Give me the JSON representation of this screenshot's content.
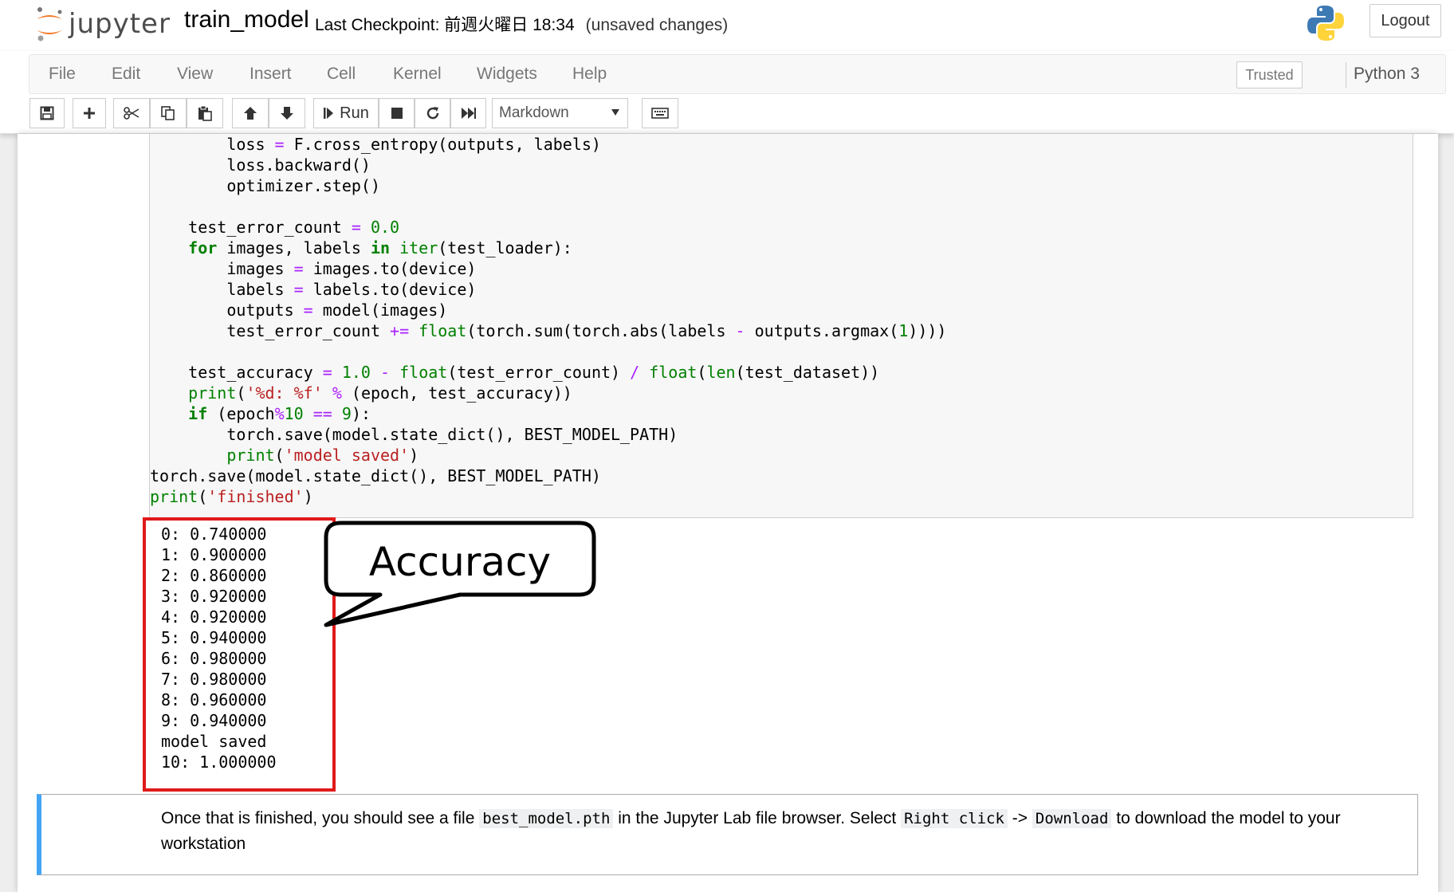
{
  "header": {
    "logo_text": "jupyter",
    "notebook_name": "train_model",
    "checkpoint_text": "Last Checkpoint: 前週火曜日 18:34",
    "unsaved_text": "(unsaved changes)",
    "logout_label": "Logout"
  },
  "menubar": {
    "items": [
      "File",
      "Edit",
      "View",
      "Insert",
      "Cell",
      "Kernel",
      "Widgets",
      "Help"
    ],
    "trusted_label": "Trusted",
    "kernel_name": "Python 3"
  },
  "toolbar": {
    "run_label": "Run",
    "cell_type": "Markdown"
  },
  "code_lines": [
    "        loss = F.cross_entropy(outputs, labels)",
    "        loss.backward()",
    "        optimizer.step()",
    "",
    "    test_error_count = 0.0",
    "    for images, labels in iter(test_loader):",
    "        images = images.to(device)",
    "        labels = labels.to(device)",
    "        outputs = model(images)",
    "        test_error_count += float(torch.sum(torch.abs(labels - outputs.argmax(1))))",
    "",
    "    test_accuracy = 1.0 - float(test_error_count) / float(len(test_dataset))",
    "    print('%d: %f' % (epoch, test_accuracy))",
    "    if (epoch%10 == 9):",
    "        torch.save(model.state_dict(), BEST_MODEL_PATH)",
    "        print('model saved')",
    "torch.save(model.state_dict(), BEST_MODEL_PATH)",
    "print('finished')"
  ],
  "output_lines": [
    "0: 0.740000",
    "1: 0.900000",
    "2: 0.860000",
    "3: 0.920000",
    "4: 0.920000",
    "5: 0.940000",
    "6: 0.980000",
    "7: 0.980000",
    "8: 0.960000",
    "9: 0.940000",
    "model saved",
    "10: 1.000000"
  ],
  "callout": {
    "text": "Accuracy"
  },
  "markdown": {
    "part1": "Once that is finished, you should see a file ",
    "code1": "best_model.pth",
    "part2": " in the Jupyter Lab file browser. Select ",
    "code2": "Right click",
    "part3": " -> ",
    "code3": "Download",
    "part4": " to download the model to your workstation"
  },
  "colors": {
    "highlight_box": "#e0191a",
    "markdown_cell_border": "#42a5f5",
    "code_keyword": "#008000",
    "code_string": "#ba2121",
    "code_operator": "#aa22ff"
  }
}
